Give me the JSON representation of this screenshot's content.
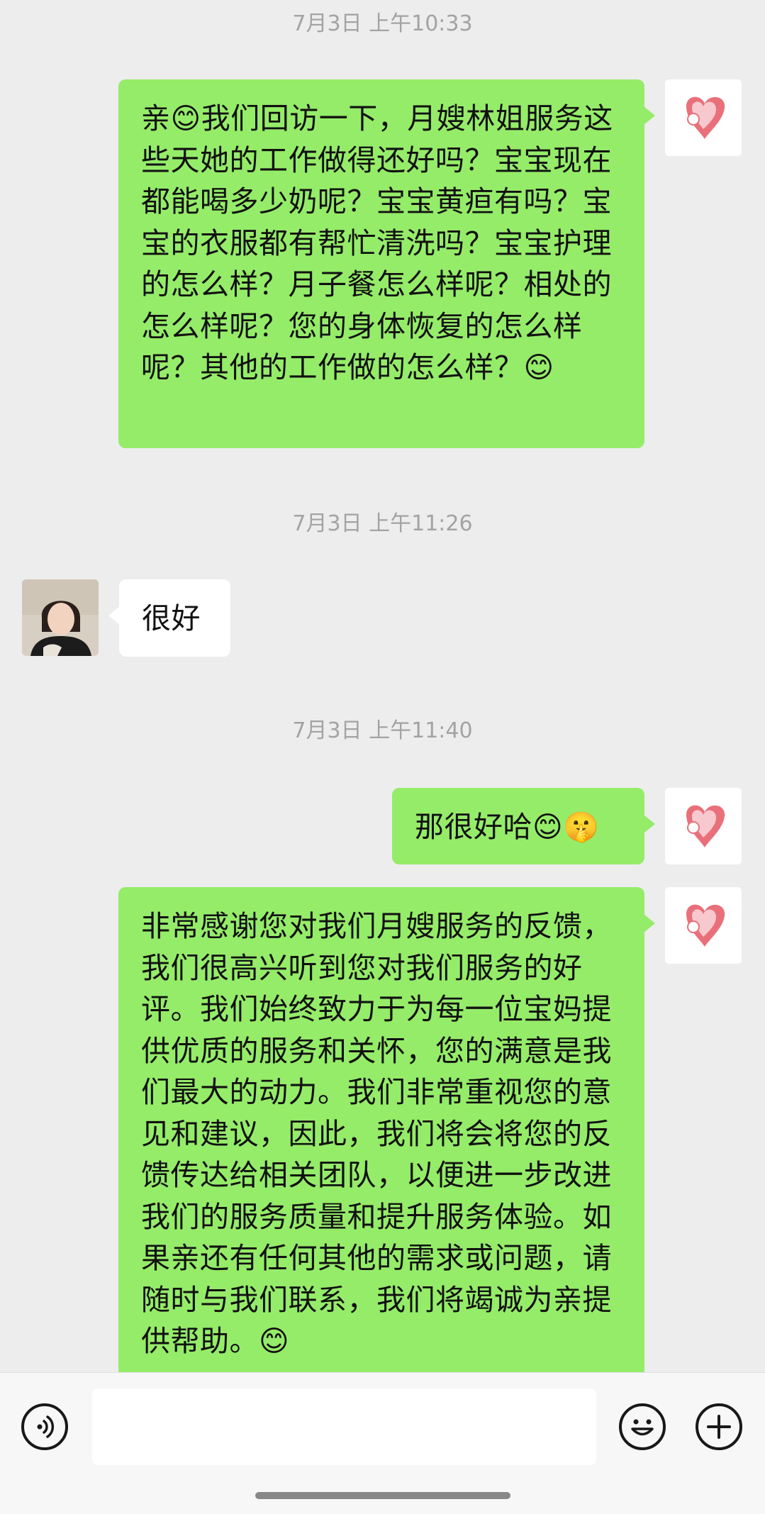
{
  "timestamps": [
    "7月3日 上午10:33",
    "7月3日 上午11:26",
    "7月3日 上午11:40"
  ],
  "messages": [
    {
      "from": "me",
      "text": "亲😊我们回访一下，月嫂林姐服务这些天她的工作做得还好吗？宝宝现在都能喝多少奶呢？宝宝黄疸有吗？宝宝的衣服都有帮忙清洗吗？宝宝护理的怎么样？月子餐怎么样呢？相处的怎么样呢？您的身体恢复的怎么样呢？其他的工作做的怎么样？😊"
    },
    {
      "from": "other",
      "text": "很好"
    },
    {
      "from": "me",
      "text": "那很好哈😊🤫"
    },
    {
      "from": "me",
      "text": "非常感谢您对我们月嫂服务的反馈，我们很高兴听到您对我们服务的好评。我们始终致力于为每一位宝妈提供优质的服务和关怀，您的满意是我们最大的动力。我们非常重视您的意见和建议，因此，我们将会将您的反馈传达给相关团队，以便进一步改进我们的服务质量和提升服务体验。如果亲还有任何其他的需求或问题，请随时与我们联系，我们将竭诚为亲提供帮助。😊"
    }
  ],
  "input": {
    "value": ""
  },
  "icons": {
    "voice": "voice-icon",
    "emoji": "emoji-icon",
    "add": "plus-icon"
  },
  "colors": {
    "sent_bubble": "#95ec69",
    "received_bubble": "#ffffff",
    "background": "#ededed"
  }
}
